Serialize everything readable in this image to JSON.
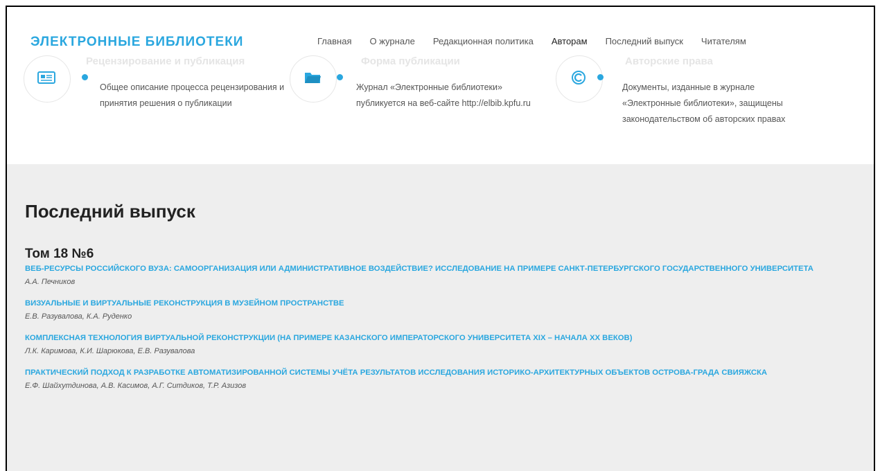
{
  "header": {
    "logo": "ЭЛЕКТРОННЫЕ БИБЛИОТЕКИ",
    "nav": [
      "Главная",
      "О журнале",
      "Редакционная политика",
      "Авторам",
      "Последний выпуск",
      "Читателям"
    ]
  },
  "features": [
    {
      "icon": "newspaper-icon",
      "title": "Рецензирование и публикация",
      "desc": "Общее описание процесса рецензирования и принятия решения о публикации"
    },
    {
      "icon": "folder-icon",
      "title": "Форма публикации",
      "desc": "Журнал «Электронные библиотеки» публикуется на веб-сайте http://elbib.kpfu.ru"
    },
    {
      "icon": "copyright-icon",
      "title": "Авторские права",
      "desc": "Документы, изданные в журнале «Электронные библиотеки», защищены законодательством об авторских правах"
    }
  ],
  "latest": {
    "heading": "Последний выпуск",
    "issue": "Том 18 №6",
    "articles": [
      {
        "title": "Веб-ресурсы российского вуза: самоорганизация или административное воздействие? Исследование на примере Санкт-Петербургского государственного университета",
        "authors": "А.А. Печников"
      },
      {
        "title": "Визуальные и виртуальные реконструкция в музейном пространстве",
        "authors": "Е.В. Разувалова, К.А. Руденко"
      },
      {
        "title": "Комплексная технология виртуальной реконструкции (на примере Казанского императорского университета XIX – начала XX веков)",
        "authors": "Л.К. Каримова, К.И. Шарюкова, Е.В. Разувалова"
      },
      {
        "title": "Практический подход к разработке автоматизированной системы учёта результатов исследования историко-архитектурных объектов острова-града Свияжска",
        "authors": "Е.Ф. Шайхутдинова, А.В. Касимов, А.Г. Ситдиков, Т.Р. Азизов"
      }
    ]
  },
  "colors": {
    "accent": "#2aa7df",
    "section_bg": "#eeeeee"
  }
}
